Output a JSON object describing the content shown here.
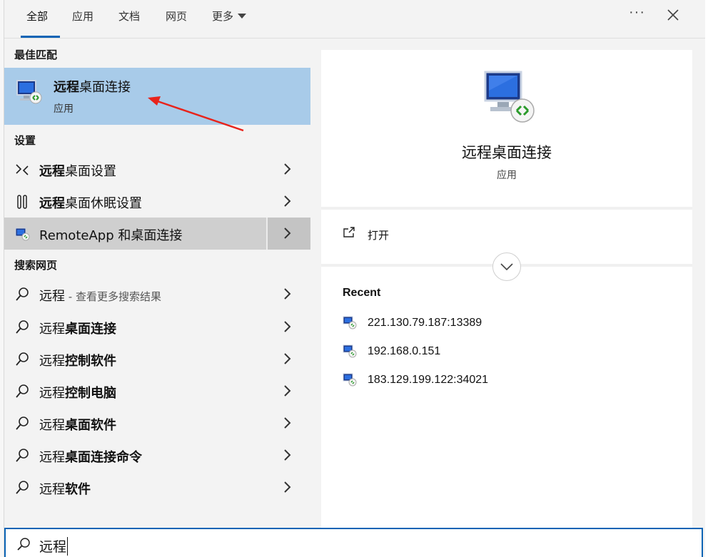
{
  "tabs": [
    {
      "label": "全部"
    },
    {
      "label": "应用"
    },
    {
      "label": "文档"
    },
    {
      "label": "网页"
    },
    {
      "label": "更多"
    }
  ],
  "toolbar": {
    "more_options_icon": "ellipsis-icon",
    "close_icon": "close-icon"
  },
  "best_match": {
    "heading": "最佳匹配",
    "title_bold": "远程",
    "title_rest": "桌面连接",
    "subtitle": "应用"
  },
  "settings": {
    "heading": "设置",
    "items": [
      {
        "bold": "远程",
        "rest": "桌面设置",
        "icon": "remote-desktop-settings-icon"
      },
      {
        "bold": "远程",
        "rest": "桌面休眠设置",
        "icon": "power-sleep-icon"
      },
      {
        "bold": "",
        "rest": "RemoteApp 和桌面连接",
        "icon": "remoteapp-icon"
      }
    ]
  },
  "web": {
    "heading": "搜索网页",
    "items": [
      {
        "plain": "远程",
        "bold": "",
        "suffix": " - 查看更多搜索结果"
      },
      {
        "plain": "远程",
        "bold": "桌面连接",
        "suffix": ""
      },
      {
        "plain": "远程",
        "bold": "控制软件",
        "suffix": ""
      },
      {
        "plain": "远程",
        "bold": "控制电脑",
        "suffix": ""
      },
      {
        "plain": "远程",
        "bold": "桌面软件",
        "suffix": ""
      },
      {
        "plain": "远程",
        "bold": "桌面连接命令",
        "suffix": ""
      },
      {
        "plain": "远程",
        "bold": "软件",
        "suffix": ""
      }
    ]
  },
  "detail": {
    "title": "远程桌面连接",
    "subtitle": "应用",
    "open_label": "打开",
    "recent_heading": "Recent",
    "recent": [
      {
        "label": "221.130.79.187:13389"
      },
      {
        "label": "192.168.0.151"
      },
      {
        "label": "183.129.199.122:34021"
      }
    ]
  },
  "search": {
    "value": "远程"
  },
  "colors": {
    "accent": "#0a64b5",
    "selection": "#a8cbe9",
    "arrow": "#e8231b"
  }
}
